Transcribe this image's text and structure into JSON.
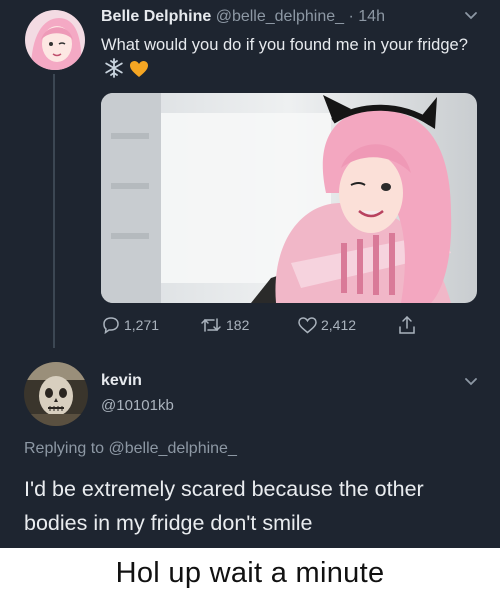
{
  "tweet": {
    "author_name": "Belle Delphine",
    "author_handle": "@belle_delphine_",
    "time": "· 14h",
    "text": "What would you do if you found me in your fridge?",
    "emoji_icons": [
      "snowflake-icon",
      "orange-heart-icon"
    ],
    "replies": "1,271",
    "retweets": "182",
    "likes": "2,412"
  },
  "reply": {
    "author_name": "kevin",
    "author_handle": "@10101kb",
    "replying_to_prefix": "Replying to",
    "replying_to_handle": "@belle_delphine_",
    "text": "I'd be extremely scared because the other bodies in my fridge don't smile"
  },
  "caption": "Hol up wait a minute",
  "colors": {
    "background": "#1e2530",
    "text": "#e7eaee",
    "muted": "#8d98a4",
    "heart": "#f5a623",
    "caption_bg": "#ffffff"
  }
}
